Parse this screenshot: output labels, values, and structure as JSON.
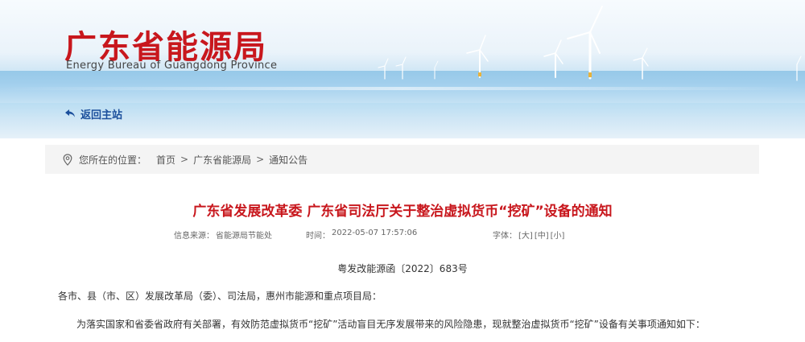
{
  "header": {
    "logo_cn": "广东省能源局",
    "logo_en": "Energy Bureau of Guangdong Province",
    "back_label": "返回主站"
  },
  "breadcrumb": {
    "prefix": "您所在的位置：",
    "items": [
      "首页",
      "广东省能源局",
      "通知公告"
    ],
    "separator": ">"
  },
  "article": {
    "title": "广东省发展改革委 广东省司法厅关于整治虚拟货币“挖矿”设备的通知",
    "source_label": "信息来源：",
    "source_value": "省能源局节能处",
    "time_label": "时间：",
    "time_value": "2022-05-07 17:57:06",
    "font_label": "字体：",
    "font_options": [
      "[大]",
      "[中]",
      "[小]"
    ],
    "doc_number": "粤发改能源函〔2022〕683号",
    "addressee": "各市、县（市、区）发展改革局（委）、司法局，惠州市能源和重点项目局：",
    "intro": "为落实国家和省委省政府有关部署，有效防范虚拟货币“挖矿”活动盲目无序发展带来的风险隐患，现就整治虚拟货币“挖矿”设备有关事项通知如下："
  },
  "colors": {
    "brand_red": "#c8171d",
    "link_blue": "#1b4f9c",
    "breadcrumb_bg": "#f4f4f4"
  },
  "icons": [
    "wind-turbine-icon",
    "back-arrow-icon",
    "location-pin-icon"
  ]
}
